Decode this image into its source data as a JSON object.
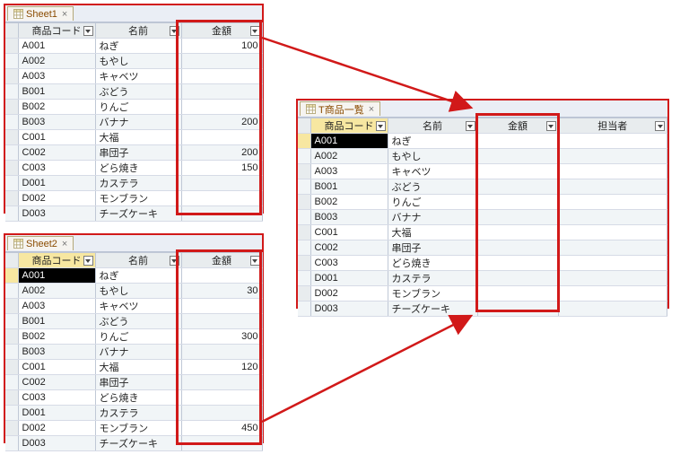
{
  "sheet1": {
    "tab_label": "Sheet1",
    "columns": [
      "商品コード",
      "名前",
      "金額"
    ],
    "rows": [
      {
        "code": "A001",
        "name": "ねぎ",
        "amount": "100"
      },
      {
        "code": "A002",
        "name": "もやし",
        "amount": ""
      },
      {
        "code": "A003",
        "name": "キャベツ",
        "amount": ""
      },
      {
        "code": "B001",
        "name": "ぶどう",
        "amount": ""
      },
      {
        "code": "B002",
        "name": "りんご",
        "amount": ""
      },
      {
        "code": "B003",
        "name": "バナナ",
        "amount": "200"
      },
      {
        "code": "C001",
        "name": "大福",
        "amount": ""
      },
      {
        "code": "C002",
        "name": "串団子",
        "amount": "200"
      },
      {
        "code": "C003",
        "name": "どら焼き",
        "amount": "150"
      },
      {
        "code": "D001",
        "name": "カステラ",
        "amount": ""
      },
      {
        "code": "D002",
        "name": "モンブラン",
        "amount": ""
      },
      {
        "code": "D003",
        "name": "チーズケーキ",
        "amount": ""
      }
    ]
  },
  "sheet2": {
    "tab_label": "Sheet2",
    "columns": [
      "商品コード",
      "名前",
      "金額"
    ],
    "rows": [
      {
        "code": "A001",
        "name": "ねぎ",
        "amount": ""
      },
      {
        "code": "A002",
        "name": "もやし",
        "amount": "30"
      },
      {
        "code": "A003",
        "name": "キャベツ",
        "amount": ""
      },
      {
        "code": "B001",
        "name": "ぶどう",
        "amount": ""
      },
      {
        "code": "B002",
        "name": "りんご",
        "amount": "300"
      },
      {
        "code": "B003",
        "name": "バナナ",
        "amount": ""
      },
      {
        "code": "C001",
        "name": "大福",
        "amount": "120"
      },
      {
        "code": "C002",
        "name": "串団子",
        "amount": ""
      },
      {
        "code": "C003",
        "name": "どら焼き",
        "amount": ""
      },
      {
        "code": "D001",
        "name": "カステラ",
        "amount": ""
      },
      {
        "code": "D002",
        "name": "モンブラン",
        "amount": "450"
      },
      {
        "code": "D003",
        "name": "チーズケーキ",
        "amount": ""
      }
    ]
  },
  "target": {
    "tab_label": "T商品一覧",
    "columns": [
      "商品コード",
      "名前",
      "金額",
      "担当者"
    ],
    "rows": [
      {
        "code": "A001",
        "name": "ねぎ",
        "amount": "",
        "rep": ""
      },
      {
        "code": "A002",
        "name": "もやし",
        "amount": "",
        "rep": ""
      },
      {
        "code": "A003",
        "name": "キャベツ",
        "amount": "",
        "rep": ""
      },
      {
        "code": "B001",
        "name": "ぶどう",
        "amount": "",
        "rep": ""
      },
      {
        "code": "B002",
        "name": "りんご",
        "amount": "",
        "rep": ""
      },
      {
        "code": "B003",
        "name": "バナナ",
        "amount": "",
        "rep": ""
      },
      {
        "code": "C001",
        "name": "大福",
        "amount": "",
        "rep": ""
      },
      {
        "code": "C002",
        "name": "串団子",
        "amount": "",
        "rep": ""
      },
      {
        "code": "C003",
        "name": "どら焼き",
        "amount": "",
        "rep": ""
      },
      {
        "code": "D001",
        "name": "カステラ",
        "amount": "",
        "rep": ""
      },
      {
        "code": "D002",
        "name": "モンブラン",
        "amount": "",
        "rep": ""
      },
      {
        "code": "D003",
        "name": "チーズケーキ",
        "amount": "",
        "rep": ""
      }
    ]
  },
  "colors": {
    "highlight": "#d11919",
    "tab_text": "#8a4b00",
    "selected_row_marker": "#f7e7a1"
  }
}
